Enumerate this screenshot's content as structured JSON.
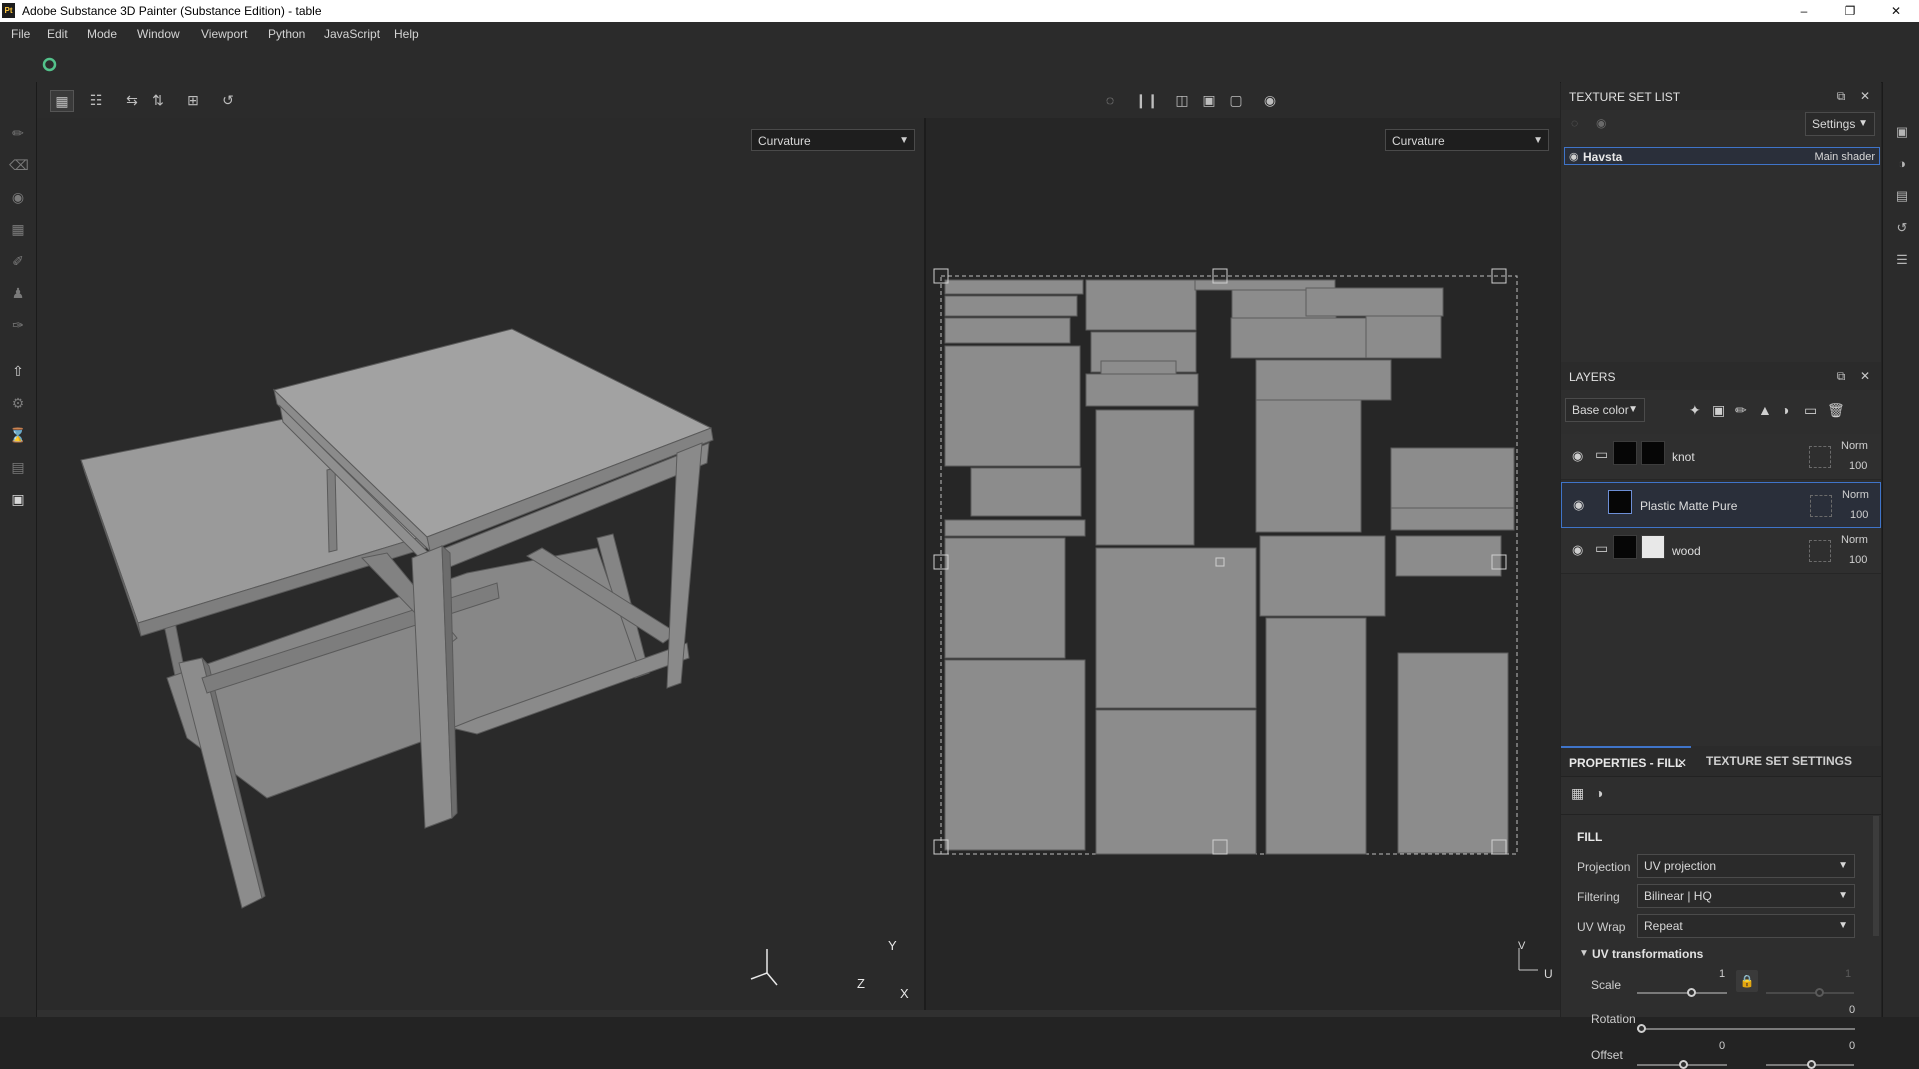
{
  "window": {
    "app_icon": "Pt",
    "title": "Adobe Substance 3D Painter (Substance Edition) - table",
    "controls": [
      "minimize-icon",
      "restore-icon",
      "close-icon"
    ]
  },
  "menu": [
    "File",
    "Edit",
    "Mode",
    "Window",
    "Viewport",
    "Python",
    "JavaScript",
    "Help"
  ],
  "viewport_3d": {
    "channel_dropdown": "Curvature"
  },
  "viewport_2d": {
    "channel_dropdown": "Curvature"
  },
  "axes_3d": {
    "x": "X",
    "y": "Y",
    "z": "Z"
  },
  "axes_2d": {
    "v": "V",
    "u": "U"
  },
  "texture_set_list": {
    "title": "TEXTURE SET LIST",
    "settings_label": "Settings",
    "items": [
      {
        "name": "Havsta",
        "shader": "Main shader"
      }
    ]
  },
  "layers": {
    "title": "LAYERS",
    "channel_dropdown": "Base color",
    "items": [
      {
        "name": "knot",
        "blend": "Norm",
        "opacity": "100"
      },
      {
        "name": "Plastic Matte Pure",
        "blend": "Norm",
        "opacity": "100"
      },
      {
        "name": "wood",
        "blend": "Norm",
        "opacity": "100"
      }
    ]
  },
  "properties": {
    "tab_fill": "PROPERTIES - FILL",
    "tab_texset": "TEXTURE SET SETTINGS",
    "section": "FILL",
    "projection_label": "Projection",
    "projection_value": "UV projection",
    "filtering_label": "Filtering",
    "filtering_value": "Bilinear | HQ",
    "uvwrap_label": "UV Wrap",
    "uvwrap_value": "Repeat",
    "uv_transform_title": "UV transformations",
    "scale_label": "Scale",
    "scale_value": "1",
    "scale_value_locked": "1",
    "rotation_label": "Rotation",
    "rotation_value": "0",
    "offset_label": "Offset",
    "offset_u": "0",
    "offset_v": "0"
  }
}
